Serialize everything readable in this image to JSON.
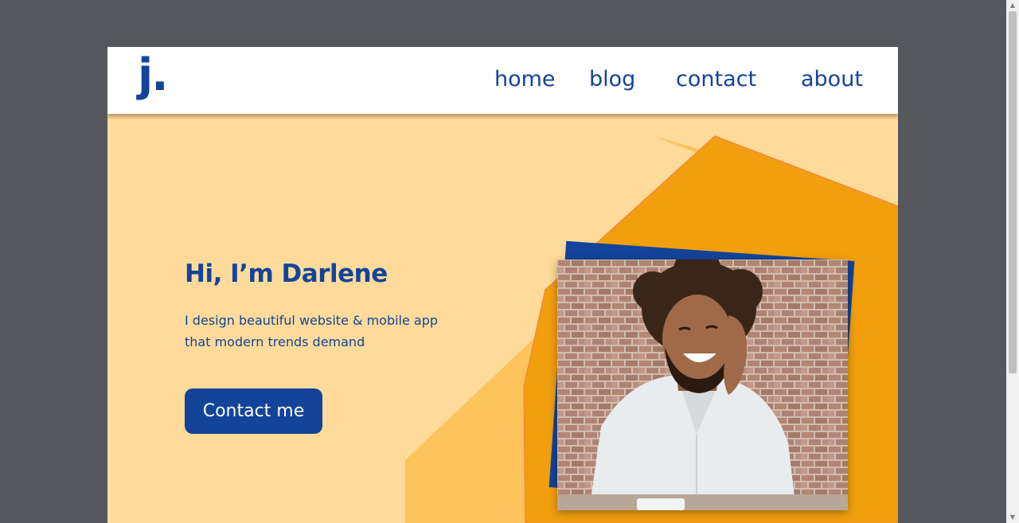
{
  "header": {
    "logo_text": "j.",
    "nav": [
      {
        "label": "home"
      },
      {
        "label": "blog"
      },
      {
        "label": "contact"
      },
      {
        "label": "about"
      }
    ]
  },
  "hero": {
    "title": "Hi, I’m Darlene",
    "subtitle": "I design beautiful website & mobile app that modern trends demand",
    "cta_label": "Contact me"
  },
  "colors": {
    "brand": "#13449a",
    "page_bg": "#fedb9a",
    "accent_orange": "#f19f0d",
    "accent_light": "#fbc04f"
  },
  "icons": {
    "scroll_up": "triangle-up-icon",
    "scroll_down": "triangle-down-icon"
  }
}
